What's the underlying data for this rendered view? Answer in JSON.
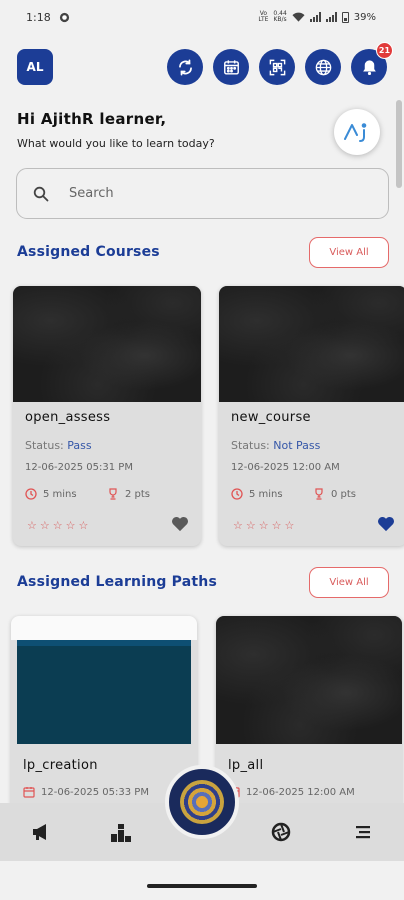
{
  "status_bar": {
    "time": "1:18",
    "network_speed_top": "0.44",
    "network_speed_bottom": "KB/s",
    "volte_top": "Vo",
    "volte_bottom": "LTE",
    "battery": "39%"
  },
  "header": {
    "avatar_initials": "AL",
    "notification_count": "21"
  },
  "greeting": {
    "title": "Hi AjithR learner,",
    "subtitle": "What would you like to learn today?"
  },
  "search": {
    "placeholder": "Search"
  },
  "assigned_courses": {
    "title": "Assigned Courses",
    "view_all": "View All",
    "status_label": "Status: ",
    "items": [
      {
        "name": "open_assess",
        "status": "Pass",
        "date": "12-06-2025 05:31 PM",
        "duration": "5 mins",
        "points": "2 pts",
        "favorite": false
      },
      {
        "name": "new_course",
        "status": "Not Pass",
        "date": "12-06-2025 12:00 AM",
        "duration": "5 mins",
        "points": "0 pts",
        "favorite": true
      }
    ]
  },
  "learning_paths": {
    "title": "Assigned Learning Paths",
    "view_all": "View All",
    "items": [
      {
        "name": "lp_creation",
        "date": "12-06-2025 05:33 PM"
      },
      {
        "name": "lp_all",
        "date": "12-06-2025 12:00 AM"
      }
    ]
  },
  "colors": {
    "primary": "#1c3d96",
    "accent": "#d95c5c",
    "card_bg": "#dedede",
    "background": "#f1f1f1"
  },
  "icons": {
    "header": [
      "refresh-icon",
      "calendar-icon",
      "scan-icon",
      "globe-icon",
      "bell-icon"
    ],
    "bottom_nav": [
      "megaphone-icon",
      "leaderboard-icon",
      "home-fab-icon",
      "aperture-icon",
      "menu-icon"
    ]
  }
}
